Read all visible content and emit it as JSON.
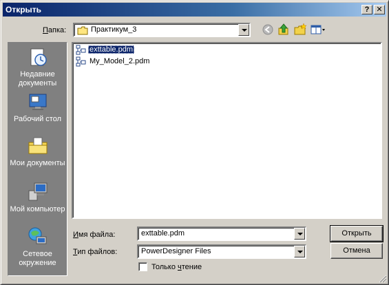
{
  "window": {
    "title": "Открыть",
    "help_button": "?",
    "close_button": "✕"
  },
  "lookin": {
    "label_prefix": "",
    "label_hotkey": "П",
    "label_rest": "апка:",
    "value": "Практикум_3"
  },
  "toolbar": {
    "icons": [
      "back-icon",
      "up-folder-icon",
      "new-folder-icon",
      "view-menu-icon"
    ]
  },
  "places": [
    {
      "icon": "recent-documents-icon",
      "label": "Недавние документы"
    },
    {
      "icon": "desktop-icon",
      "label": "Рабочий стол"
    },
    {
      "icon": "my-documents-icon",
      "label": "Мои документы"
    },
    {
      "icon": "my-computer-icon",
      "label": "Мой компьютер"
    },
    {
      "icon": "network-places-icon",
      "label": "Сетевое окружение"
    }
  ],
  "files": [
    {
      "name": "exttable.pdm",
      "selected": true
    },
    {
      "name": "My_Model_2.pdm",
      "selected": false
    }
  ],
  "filename": {
    "label_prefix": "",
    "label_hotkey": "И",
    "label_rest": "мя файла:",
    "value": "exttable.pdm"
  },
  "filetype": {
    "label_prefix": "",
    "label_hotkey": "Т",
    "label_rest": "ип файлов:",
    "value": "PowerDesigner Files"
  },
  "readonly": {
    "label_prefix": "Только ",
    "label_hotkey": "ч",
    "label_rest": "тение",
    "checked": false
  },
  "buttons": {
    "open": "Открыть",
    "cancel": "Отмена"
  }
}
